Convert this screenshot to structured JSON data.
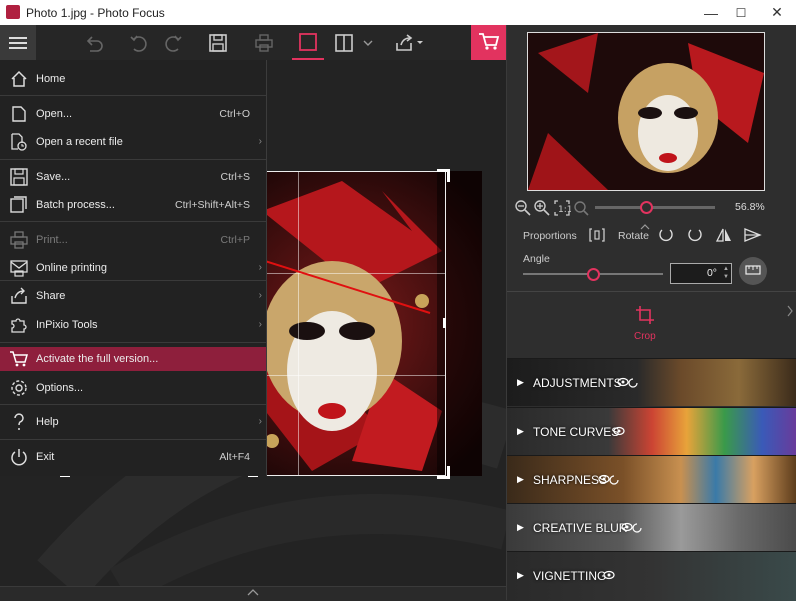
{
  "window": {
    "title": "Photo 1.jpg - Photo Focus",
    "minimize": "—",
    "maximize": "☐",
    "close": "✕"
  },
  "menu": {
    "items": [
      {
        "label": "Home",
        "shortcut": "",
        "submenu": false,
        "icon": "home-icon"
      },
      {
        "label": "Open...",
        "shortcut": "Ctrl+O",
        "submenu": false,
        "icon": "open-icon"
      },
      {
        "label": "Open a recent file",
        "shortcut": "",
        "submenu": true,
        "icon": "recent-file-icon"
      },
      {
        "label": "Save...",
        "shortcut": "Ctrl+S",
        "submenu": false,
        "icon": "save-icon"
      },
      {
        "label": "Batch process...",
        "shortcut": "Ctrl+Shift+Alt+S",
        "submenu": false,
        "icon": "batch-icon"
      },
      {
        "label": "Print...",
        "shortcut": "Ctrl+P",
        "submenu": false,
        "icon": "print-icon",
        "disabled": true
      },
      {
        "label": "Online printing",
        "shortcut": "",
        "submenu": true,
        "icon": "online-print-icon"
      },
      {
        "label": "Share",
        "shortcut": "",
        "submenu": true,
        "icon": "share-icon"
      },
      {
        "label": "InPixio Tools",
        "shortcut": "",
        "submenu": true,
        "icon": "puzzle-icon"
      },
      {
        "label": "Activate the full version...",
        "shortcut": "",
        "submenu": false,
        "icon": "cart-icon",
        "highlight": true
      },
      {
        "label": "Options...",
        "shortcut": "",
        "submenu": false,
        "icon": "gear-icon"
      },
      {
        "label": "Help",
        "shortcut": "",
        "submenu": true,
        "icon": "help-icon"
      },
      {
        "label": "Exit",
        "shortcut": "Alt+F4",
        "submenu": false,
        "icon": "power-icon"
      }
    ]
  },
  "navigator": {
    "zoom": "56.8%",
    "zoom_fraction": 0.3
  },
  "tools": {
    "proportions_label": "Proportions",
    "rotate_label": "Rotate",
    "angle_label": "Angle",
    "angle_value": "0°",
    "angle_fraction": 0.5,
    "crop_label": "Crop"
  },
  "panels": [
    {
      "label": "ADJUSTMENTS"
    },
    {
      "label": "TONE CURVES"
    },
    {
      "label": "SHARPNESS"
    },
    {
      "label": "CREATIVE BLUR"
    },
    {
      "label": "VIGNETTING"
    }
  ],
  "colors": {
    "accent": "#e2335f",
    "highlight": "#8e1f3c",
    "menu_bg": "#222222"
  }
}
